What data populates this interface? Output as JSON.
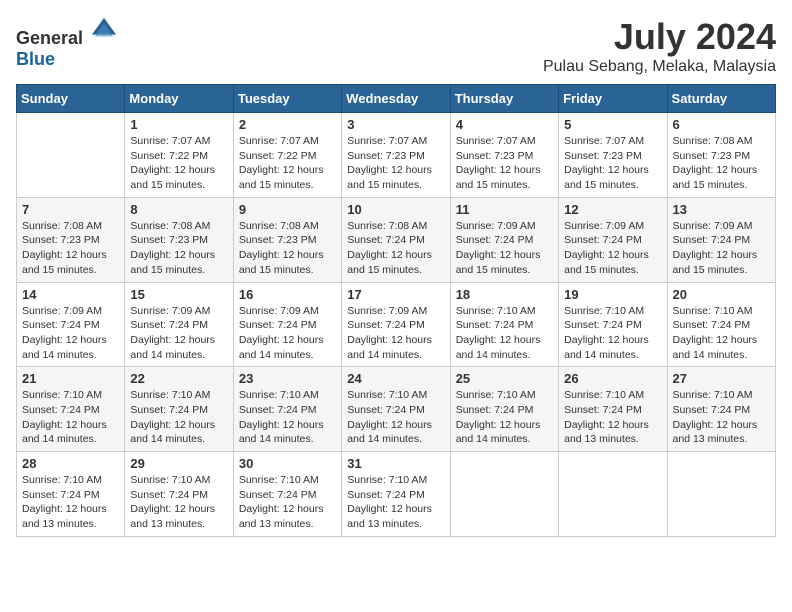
{
  "header": {
    "logo_general": "General",
    "logo_blue": "Blue",
    "month_year": "July 2024",
    "location": "Pulau Sebang, Melaka, Malaysia"
  },
  "days_of_week": [
    "Sunday",
    "Monday",
    "Tuesday",
    "Wednesday",
    "Thursday",
    "Friday",
    "Saturday"
  ],
  "weeks": [
    [
      {
        "day": "",
        "sunrise": "",
        "sunset": "",
        "daylight": ""
      },
      {
        "day": "1",
        "sunrise": "Sunrise: 7:07 AM",
        "sunset": "Sunset: 7:22 PM",
        "daylight": "Daylight: 12 hours and 15 minutes."
      },
      {
        "day": "2",
        "sunrise": "Sunrise: 7:07 AM",
        "sunset": "Sunset: 7:22 PM",
        "daylight": "Daylight: 12 hours and 15 minutes."
      },
      {
        "day": "3",
        "sunrise": "Sunrise: 7:07 AM",
        "sunset": "Sunset: 7:23 PM",
        "daylight": "Daylight: 12 hours and 15 minutes."
      },
      {
        "day": "4",
        "sunrise": "Sunrise: 7:07 AM",
        "sunset": "Sunset: 7:23 PM",
        "daylight": "Daylight: 12 hours and 15 minutes."
      },
      {
        "day": "5",
        "sunrise": "Sunrise: 7:07 AM",
        "sunset": "Sunset: 7:23 PM",
        "daylight": "Daylight: 12 hours and 15 minutes."
      },
      {
        "day": "6",
        "sunrise": "Sunrise: 7:08 AM",
        "sunset": "Sunset: 7:23 PM",
        "daylight": "Daylight: 12 hours and 15 minutes."
      }
    ],
    [
      {
        "day": "7",
        "sunrise": "Sunrise: 7:08 AM",
        "sunset": "Sunset: 7:23 PM",
        "daylight": "Daylight: 12 hours and 15 minutes."
      },
      {
        "day": "8",
        "sunrise": "Sunrise: 7:08 AM",
        "sunset": "Sunset: 7:23 PM",
        "daylight": "Daylight: 12 hours and 15 minutes."
      },
      {
        "day": "9",
        "sunrise": "Sunrise: 7:08 AM",
        "sunset": "Sunset: 7:23 PM",
        "daylight": "Daylight: 12 hours and 15 minutes."
      },
      {
        "day": "10",
        "sunrise": "Sunrise: 7:08 AM",
        "sunset": "Sunset: 7:24 PM",
        "daylight": "Daylight: 12 hours and 15 minutes."
      },
      {
        "day": "11",
        "sunrise": "Sunrise: 7:09 AM",
        "sunset": "Sunset: 7:24 PM",
        "daylight": "Daylight: 12 hours and 15 minutes."
      },
      {
        "day": "12",
        "sunrise": "Sunrise: 7:09 AM",
        "sunset": "Sunset: 7:24 PM",
        "daylight": "Daylight: 12 hours and 15 minutes."
      },
      {
        "day": "13",
        "sunrise": "Sunrise: 7:09 AM",
        "sunset": "Sunset: 7:24 PM",
        "daylight": "Daylight: 12 hours and 15 minutes."
      }
    ],
    [
      {
        "day": "14",
        "sunrise": "Sunrise: 7:09 AM",
        "sunset": "Sunset: 7:24 PM",
        "daylight": "Daylight: 12 hours and 14 minutes."
      },
      {
        "day": "15",
        "sunrise": "Sunrise: 7:09 AM",
        "sunset": "Sunset: 7:24 PM",
        "daylight": "Daylight: 12 hours and 14 minutes."
      },
      {
        "day": "16",
        "sunrise": "Sunrise: 7:09 AM",
        "sunset": "Sunset: 7:24 PM",
        "daylight": "Daylight: 12 hours and 14 minutes."
      },
      {
        "day": "17",
        "sunrise": "Sunrise: 7:09 AM",
        "sunset": "Sunset: 7:24 PM",
        "daylight": "Daylight: 12 hours and 14 minutes."
      },
      {
        "day": "18",
        "sunrise": "Sunrise: 7:10 AM",
        "sunset": "Sunset: 7:24 PM",
        "daylight": "Daylight: 12 hours and 14 minutes."
      },
      {
        "day": "19",
        "sunrise": "Sunrise: 7:10 AM",
        "sunset": "Sunset: 7:24 PM",
        "daylight": "Daylight: 12 hours and 14 minutes."
      },
      {
        "day": "20",
        "sunrise": "Sunrise: 7:10 AM",
        "sunset": "Sunset: 7:24 PM",
        "daylight": "Daylight: 12 hours and 14 minutes."
      }
    ],
    [
      {
        "day": "21",
        "sunrise": "Sunrise: 7:10 AM",
        "sunset": "Sunset: 7:24 PM",
        "daylight": "Daylight: 12 hours and 14 minutes."
      },
      {
        "day": "22",
        "sunrise": "Sunrise: 7:10 AM",
        "sunset": "Sunset: 7:24 PM",
        "daylight": "Daylight: 12 hours and 14 minutes."
      },
      {
        "day": "23",
        "sunrise": "Sunrise: 7:10 AM",
        "sunset": "Sunset: 7:24 PM",
        "daylight": "Daylight: 12 hours and 14 minutes."
      },
      {
        "day": "24",
        "sunrise": "Sunrise: 7:10 AM",
        "sunset": "Sunset: 7:24 PM",
        "daylight": "Daylight: 12 hours and 14 minutes."
      },
      {
        "day": "25",
        "sunrise": "Sunrise: 7:10 AM",
        "sunset": "Sunset: 7:24 PM",
        "daylight": "Daylight: 12 hours and 14 minutes."
      },
      {
        "day": "26",
        "sunrise": "Sunrise: 7:10 AM",
        "sunset": "Sunset: 7:24 PM",
        "daylight": "Daylight: 12 hours and 13 minutes."
      },
      {
        "day": "27",
        "sunrise": "Sunrise: 7:10 AM",
        "sunset": "Sunset: 7:24 PM",
        "daylight": "Daylight: 12 hours and 13 minutes."
      }
    ],
    [
      {
        "day": "28",
        "sunrise": "Sunrise: 7:10 AM",
        "sunset": "Sunset: 7:24 PM",
        "daylight": "Daylight: 12 hours and 13 minutes."
      },
      {
        "day": "29",
        "sunrise": "Sunrise: 7:10 AM",
        "sunset": "Sunset: 7:24 PM",
        "daylight": "Daylight: 12 hours and 13 minutes."
      },
      {
        "day": "30",
        "sunrise": "Sunrise: 7:10 AM",
        "sunset": "Sunset: 7:24 PM",
        "daylight": "Daylight: 12 hours and 13 minutes."
      },
      {
        "day": "31",
        "sunrise": "Sunrise: 7:10 AM",
        "sunset": "Sunset: 7:24 PM",
        "daylight": "Daylight: 12 hours and 13 minutes."
      },
      {
        "day": "",
        "sunrise": "",
        "sunset": "",
        "daylight": ""
      },
      {
        "day": "",
        "sunrise": "",
        "sunset": "",
        "daylight": ""
      },
      {
        "day": "",
        "sunrise": "",
        "sunset": "",
        "daylight": ""
      }
    ]
  ]
}
